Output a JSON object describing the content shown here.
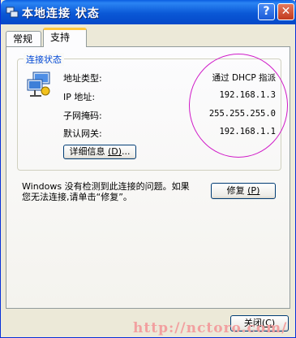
{
  "window": {
    "title": "本地连接 状态",
    "help_label": "?",
    "close_label": "✕"
  },
  "tabs": [
    {
      "label": "常规",
      "active": false
    },
    {
      "label": "支持",
      "active": true
    }
  ],
  "connection_status": {
    "group_title": "连接状态",
    "rows": [
      {
        "label": "地址类型:",
        "value": "通过 DHCP 指派"
      },
      {
        "label": "IP 地址:",
        "value": "192.168.1.3"
      },
      {
        "label": "子网掩码:",
        "value": "255.255.255.0"
      },
      {
        "label": "默认网关:",
        "value": "192.168.1.1"
      }
    ],
    "details_button": {
      "text": "详细信息 ",
      "accel": "(D)",
      "suffix": "..."
    }
  },
  "repair": {
    "line1": "Windows 没有检测到此连接的问题。如果",
    "line2": "您无法连接,请单击“修复”。",
    "button": {
      "text": "修复 ",
      "accel": "(P)"
    }
  },
  "footer": {
    "close_button": {
      "text": "关闭",
      "accel": "(C)"
    }
  },
  "watermark": "http://nctoro.com/",
  "colors": {
    "titlebar": "#0a58d6",
    "group_title": "#0046d5",
    "annotation_circle": "#d01bc8",
    "watermark": "#f2a0a0"
  }
}
